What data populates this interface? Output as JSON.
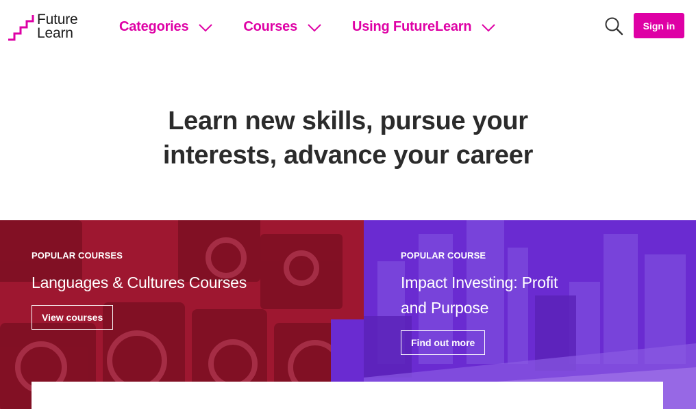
{
  "brand": {
    "line1": "Future",
    "line2": "Learn",
    "accent": "#de00a5"
  },
  "nav": {
    "items": [
      {
        "label": "Categories"
      },
      {
        "label": "Courses"
      },
      {
        "label": "Using FutureLearn"
      }
    ]
  },
  "header": {
    "search_icon": "search-icon",
    "signin_label": "Sign in"
  },
  "hero": {
    "line1": "Learn new skills, pursue your",
    "line2": "interests, advance your career"
  },
  "promos": [
    {
      "eyebrow": "POPULAR COURSES",
      "title": "Languages & Cultures Courses",
      "button": "View courses",
      "color": "#9e1730"
    },
    {
      "eyebrow": "POPULAR COURSE",
      "title_line1": "Impact Investing: Profit",
      "title_line2": "and Purpose",
      "button": "Find out more",
      "color": "#6a2bd1"
    }
  ]
}
